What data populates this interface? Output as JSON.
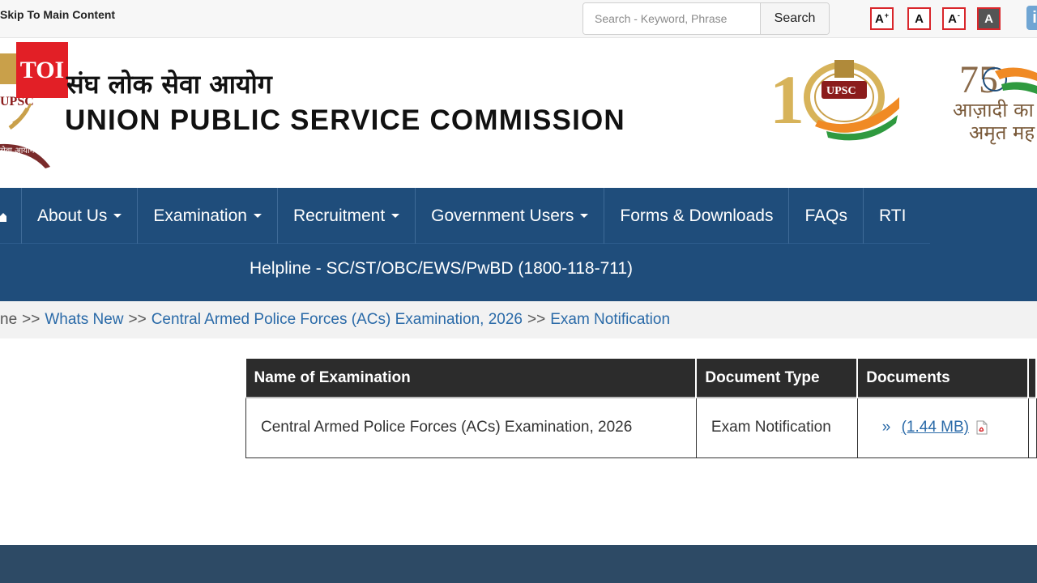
{
  "topbar": {
    "skip_label": "Skip To Main Content",
    "search_placeholder": "Search - Keyword, Phrase",
    "search_button": "Search",
    "font_controls": [
      "A",
      "A",
      "A",
      "A"
    ]
  },
  "header": {
    "toi_label": "TOI",
    "hindi_title": "संघ लोक सेवा आयोग",
    "english_title": "UNION PUBLIC SERVICE COMMISSION",
    "emblem_text": "UPSC",
    "centenary_badge": "UPSC",
    "centenary_number": "100",
    "azadi_line1": "आज़ादी का",
    "azadi_line2": "अमृत मह"
  },
  "nav": {
    "items": [
      {
        "label": "About Us",
        "dropdown": true
      },
      {
        "label": "Examination",
        "dropdown": true
      },
      {
        "label": "Recruitment",
        "dropdown": true
      },
      {
        "label": "Government Users",
        "dropdown": true
      },
      {
        "label": "Forms & Downloads",
        "dropdown": false
      },
      {
        "label": "FAQs",
        "dropdown": false
      },
      {
        "label": "RTI",
        "dropdown": false
      }
    ],
    "helpline": "Helpline - SC/ST/OBC/EWS/PwBD (1800-118-711)"
  },
  "breadcrumb": {
    "home_partial": "ne",
    "separator": ">>",
    "items": [
      "Whats New",
      "Central Armed Police Forces (ACs) Examination, 2026",
      "Exam Notification"
    ]
  },
  "table": {
    "headers": [
      "Name of Examination",
      "Document Type",
      "Documents"
    ],
    "rows": [
      {
        "name": "Central Armed Police Forces (ACs) Examination, 2026",
        "type": "Exam Notification",
        "bullet": "»",
        "link_text": "(1.44 MB)"
      }
    ]
  },
  "colors": {
    "nav_bg": "#1f4d7b",
    "toi_red": "#e21f26",
    "link_blue": "#2a6aa8",
    "table_header": "#2c2c2c",
    "footer_bg": "#2d4a65"
  }
}
